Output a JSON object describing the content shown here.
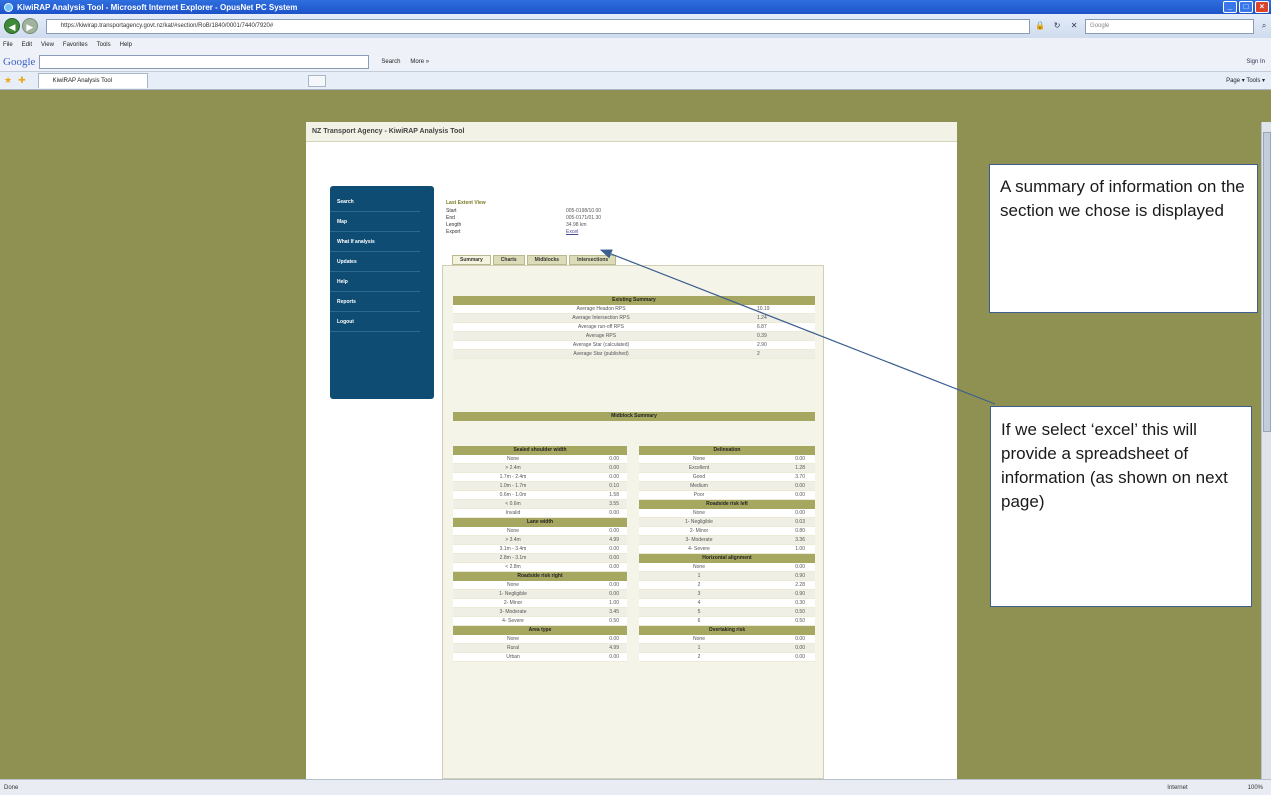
{
  "browser": {
    "window_title": "KiwiRAP Analysis Tool - Microsoft Internet Explorer - OpusNet PC System",
    "url": "https://kiwirap.transportagency.govt.nz/kat/#section/RoB/1840/0001/7440/7920#",
    "search_placeholder": "Google",
    "menu": [
      "File",
      "Edit",
      "View",
      "Favorites",
      "Tools",
      "Help"
    ],
    "google_logo": "Google",
    "google_search_label": "Search",
    "google_more_label": "More »",
    "signin_label": "Sign In",
    "tab_title": "KiwiRAP Analysis Tool",
    "command_bar": "Page ▾  Tools ▾",
    "status_text": "Done",
    "status_zone": "Internet",
    "status_zoom": "100%"
  },
  "app": {
    "header": "NZ Transport Agency - KiwiRAP Analysis Tool",
    "sidebar": [
      "Search",
      "Map",
      "What If analysis",
      "Updates",
      "Help",
      "Reports",
      "Logout"
    ],
    "last_extent_label": "Last Extent",
    "last_extent_link": "View",
    "info": [
      {
        "label": "Start",
        "value": "005-0198/10.00"
      },
      {
        "label": "End",
        "value": "005-0171/01.30"
      },
      {
        "label": "Length",
        "value": "34.98 km"
      },
      {
        "label": "Export",
        "value": "Excel"
      }
    ],
    "tabs": [
      "Summary",
      "Charts",
      "Midblocks",
      "Intersections"
    ],
    "existing_summary": {
      "title": "Existing Summary",
      "rows": [
        {
          "label": "Average Headon RPS",
          "value": "10.19"
        },
        {
          "label": "Average Intersection RPS",
          "value": "1.24"
        },
        {
          "label": "Average run-off RPS",
          "value": "6.87"
        },
        {
          "label": "Average RPS",
          "value": "0.39"
        },
        {
          "label": "Average Star (calculated)",
          "value": "2.90"
        },
        {
          "label": "Average Star (published)",
          "value": "2"
        }
      ]
    },
    "midblock_title": "Midblock Summary",
    "left_tables": [
      {
        "title": "Sealed shoulder width",
        "rows": [
          [
            "None",
            "0.00"
          ],
          [
            "> 2.4m",
            "0.00"
          ],
          [
            "1.7m - 2.4m",
            "0.00"
          ],
          [
            "1.0m - 1.7m",
            "0.10"
          ],
          [
            "0.6m - 1.0m",
            "1.58"
          ],
          [
            "< 0.6m",
            "3.55"
          ],
          [
            "Invalid",
            "0.00"
          ]
        ]
      },
      {
        "title": "Lane width",
        "rows": [
          [
            "None",
            "0.00"
          ],
          [
            "> 3.4m",
            "4.99"
          ],
          [
            "3.1m - 3.4m",
            "0.00"
          ],
          [
            "2.8m - 3.1m",
            "0.00"
          ],
          [
            "< 2.8m",
            "0.00"
          ]
        ]
      },
      {
        "title": "Roadside risk right",
        "rows": [
          [
            "None",
            "0.00"
          ],
          [
            "1- Negligible",
            "0.00"
          ],
          [
            "2- Minor",
            "1.00"
          ],
          [
            "3- Moderate",
            "3.45"
          ],
          [
            "4- Severe",
            "0.50"
          ]
        ]
      },
      {
        "title": "Area type",
        "rows": [
          [
            "None",
            "0.00"
          ],
          [
            "Rural",
            "4.99"
          ],
          [
            "Urban",
            "0.00"
          ]
        ]
      }
    ],
    "right_tables": [
      {
        "title": "Delineation",
        "rows": [
          [
            "None",
            "0.00"
          ],
          [
            "Excellent",
            "1.28"
          ],
          [
            "Good",
            "3.70"
          ],
          [
            "Medium",
            "0.00"
          ],
          [
            "Poor",
            "0.00"
          ]
        ]
      },
      {
        "title": "Roadside risk left",
        "rows": [
          [
            "None",
            "0.00"
          ],
          [
            "1- Negligible",
            "0.03"
          ],
          [
            "2- Minor",
            "0.80"
          ],
          [
            "3- Moderate",
            "3.36"
          ],
          [
            "4- Severe",
            "1.00"
          ]
        ]
      },
      {
        "title": "Horizontal alignment",
        "rows": [
          [
            "None",
            "0.00"
          ],
          [
            "1",
            "0.90"
          ],
          [
            "2",
            "2.28"
          ],
          [
            "3",
            "0.90"
          ],
          [
            "4",
            "0.30"
          ],
          [
            "5",
            "0.50"
          ],
          [
            "6",
            "0.50"
          ]
        ]
      },
      {
        "title": "Overtaking risk",
        "rows": [
          [
            "None",
            "0.00"
          ],
          [
            "1",
            "0.00"
          ],
          [
            "2",
            "0.00"
          ]
        ]
      }
    ]
  },
  "annotations": {
    "callout_1": "A summary of information on the section  we chose is displayed",
    "callout_2": "If we select ‘excel’ this will provide a spreadsheet of information (as shown on next page)",
    "arrow_color": "#3c5f8f"
  }
}
